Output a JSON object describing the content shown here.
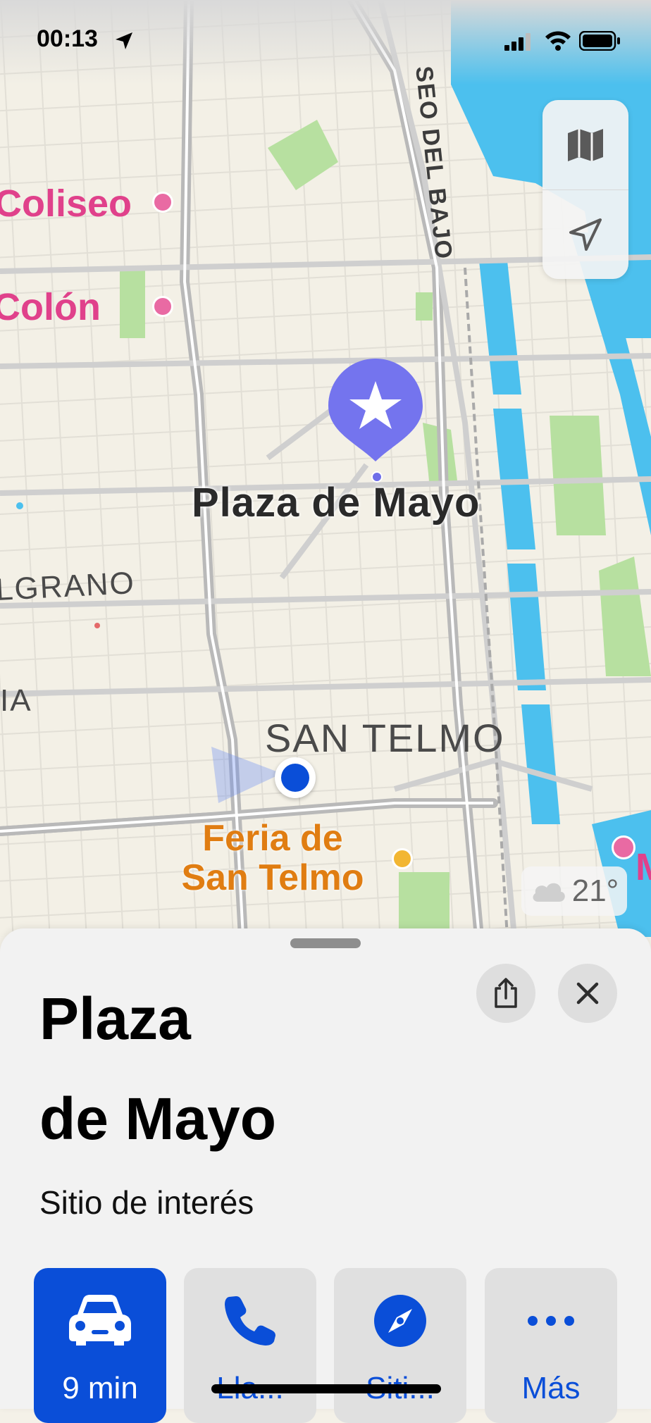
{
  "status_bar": {
    "time": "00:13"
  },
  "map": {
    "pois": {
      "coliseo": "Coliseo",
      "colon": "Colón"
    },
    "streets": {
      "paseo_del_bajo": "SEO DEL BAJO"
    },
    "districts": {
      "belgrano": "LGRANO",
      "ia": "IA",
      "san_telmo": "SAN TELMO"
    },
    "selected_place_label": "Plaza de Mayo",
    "feria_line1": "Feria de",
    "feria_line2": "San Telmo",
    "weather_temp": "21°",
    "edge_partial": "M"
  },
  "sheet": {
    "title_line1": "Plaza",
    "title_line2": "de Mayo",
    "subtitle": "Sitio de interés",
    "actions": [
      {
        "label": "9 min",
        "icon": "car-icon"
      },
      {
        "label": "Lla...",
        "icon": "phone-icon"
      },
      {
        "label": "Siti...",
        "icon": "compass-icon"
      },
      {
        "label": "Más",
        "icon": "more-icon"
      }
    ]
  },
  "colors": {
    "accent": "#0a4ed8",
    "pin": "#7474ee",
    "poi_pink": "#e0418b",
    "poi_orange": "#e07d12",
    "water": "#4cc0ee"
  }
}
